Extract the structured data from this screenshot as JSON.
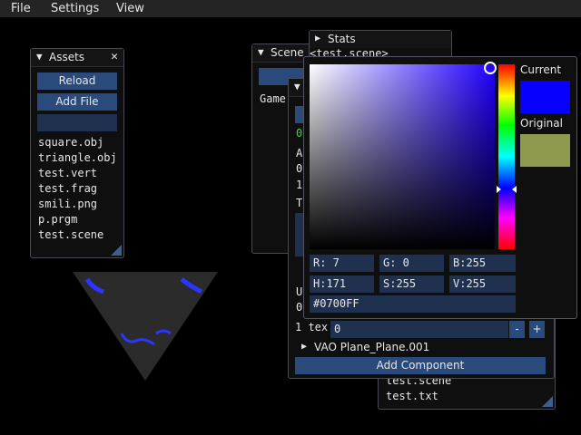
{
  "menubar": {
    "file": "File",
    "settings": "Settings",
    "view": "View"
  },
  "assets": {
    "title": "Assets",
    "close": "✕",
    "reload": "Reload",
    "add_file": "Add File",
    "files": [
      "square.obj",
      "triangle.obj",
      "test.vert",
      "test.frag",
      "smili.png",
      "p.prgm",
      "test.scene"
    ]
  },
  "scene": {
    "title": "Scene",
    "gameobject_partial": "Game("
  },
  "stats": {
    "title": "Stats",
    "scene_label": "<test.scene>"
  },
  "inspector": {
    "row_a": "A",
    "row_0": "0",
    "row_1": "1",
    "row_t": "T",
    "row_u": "U",
    "row_00": "0",
    "tex_label": "1 tex",
    "tex_value": "0",
    "minus": "-",
    "plus": "+",
    "vao_label": "VAO Plane_Plane.001",
    "add_component": "Add Component"
  },
  "back_panel": {
    "files": [
      "test.scene",
      "test.txt"
    ]
  },
  "color_picker": {
    "r": "R:  7",
    "g": "G:  0",
    "b": "B:255",
    "h": "H:171",
    "s": "S:255",
    "v": "V:255",
    "hex": "#0700FF",
    "current_label": "Current",
    "original_label": "Original",
    "current_color": "#0700FF",
    "original_color": "#8f9a4f",
    "hue_color": "#1f00ff"
  }
}
